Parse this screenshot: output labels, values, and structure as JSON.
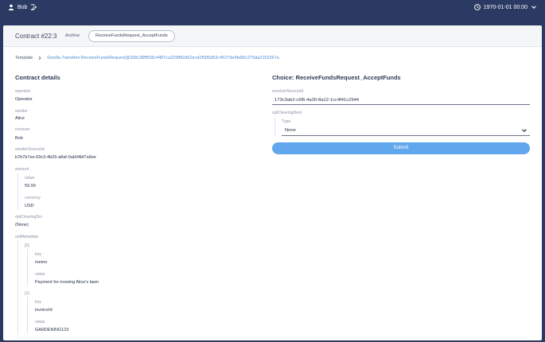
{
  "topbar": {
    "user_name": "Bob",
    "datetime": "1970-01-01 00:00"
  },
  "header": {
    "contract_id": "Contract #22:3",
    "archive_label": "Archive",
    "choice_pill": "ReceiveFundsRequest_AcceptFunds"
  },
  "breadcrumb": {
    "root": "Template",
    "template_id": "Dwolla.Transfers:ReceiveFundsRequest@398c38ff558c4487ca329ff82d62ecd2f585d53c4527de4fa89c279da2153267a"
  },
  "details": {
    "title": "Contract details",
    "operator_label": "operator",
    "operator_value": "Operator",
    "sender_label": "sender",
    "sender_value": "Alice",
    "receiver_label": "receiver",
    "receiver_value": "Bob",
    "senderSourceId_label": "senderSourceId",
    "senderSourceId_value": "b7b7b7ee-69c3-4b26-a8af-0ab04bf7a9ee",
    "amount_label": "amount",
    "amount_value_label": "value",
    "amount_value": "59.99",
    "currency_label": "currency",
    "currency_value": "USD",
    "optClearingSrc_label": "optClearingSrc",
    "optClearingSrc_value": "(None)",
    "optMetadata_label": "optMetadata",
    "meta": [
      {
        "index": "[0]",
        "key_label": "key",
        "key_value": "memo",
        "value_label": "value",
        "value_value": "Payment for mowing Alice's lawn"
      },
      {
        "index": "[1]",
        "key_label": "key",
        "key_value": "invoiceId",
        "value_label": "value",
        "value_value": "GARDENING123"
      }
    ]
  },
  "choice": {
    "title": "Choice: ReceiveFundsRequest_AcceptFunds",
    "receiverSourceId_label": "receiverSourceId",
    "receiverSourceId_value": "173c3ab2-c5f6-4a30-8a12-1cc4f41c2944",
    "optClearingDest_label": "optClearingDest",
    "type_label": "Type",
    "type_value": "None",
    "submit_label": "Submit"
  },
  "icons": {
    "user": "user-icon",
    "logout": "logout-icon",
    "clock": "clock-icon",
    "chevron": "chevron-down-icon",
    "breadcrumb_sep": "chevron-right-icon"
  },
  "colors": {
    "topbar": "#2b3a63",
    "accent": "#60a7ee",
    "link": "#4d8fd6"
  }
}
